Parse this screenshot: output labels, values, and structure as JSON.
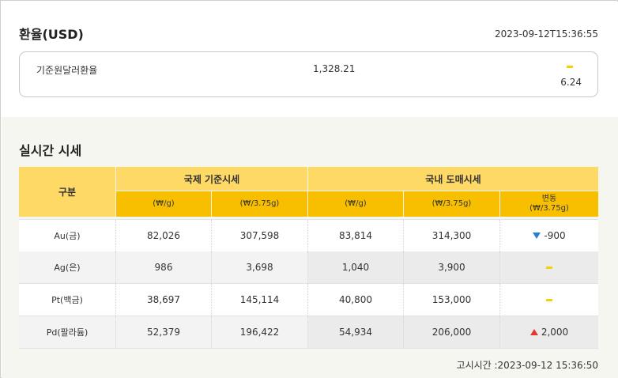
{
  "exchange": {
    "title": "환율(USD)",
    "timestamp": "2023-09-12T15:36:55",
    "label": "기준원달러환율",
    "value": "1,328.21",
    "change": "6.24",
    "change_direction": "flat"
  },
  "live": {
    "title": "실시간 시세",
    "headers": {
      "category": "구분",
      "international": "국제 기준시세",
      "domestic": "국내 도매시세",
      "intl_per_g": "(₩/g)",
      "intl_per_don": "(₩/3.75g)",
      "dom_per_g": "(₩/g)",
      "dom_per_don": "(₩/3.75g)",
      "change_line1": "변동",
      "change_line2": "(₩/3.75g)"
    },
    "rows": [
      {
        "name": "Au(금)",
        "intl_g": "82,026",
        "intl_don": "307,598",
        "dom_g": "83,814",
        "dom_don": "314,300",
        "change": "-900",
        "direction": "down"
      },
      {
        "name": "Ag(은)",
        "intl_g": "986",
        "intl_don": "3,698",
        "dom_g": "1,040",
        "dom_don": "3,900",
        "change": "",
        "direction": "flat"
      },
      {
        "name": "Pt(백금)",
        "intl_g": "38,697",
        "intl_don": "145,114",
        "dom_g": "40,800",
        "dom_don": "153,000",
        "change": "",
        "direction": "flat"
      },
      {
        "name": "Pd(팔라듐)",
        "intl_g": "52,379",
        "intl_don": "196,422",
        "dom_g": "54,934",
        "dom_don": "206,000",
        "change": "2,000",
        "direction": "up"
      }
    ],
    "notice": "고시시간 :2023-09-12 15:36:50"
  },
  "colors": {
    "header_light": "#ffd966",
    "header_dark": "#f7bf00",
    "up": "#e23a2e",
    "down": "#2a7fd4",
    "flat": "#f2d200"
  }
}
